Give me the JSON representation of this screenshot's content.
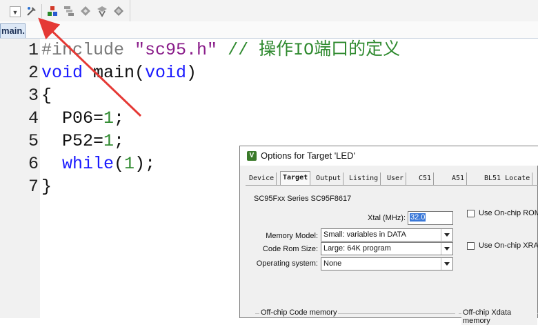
{
  "toolbar": {
    "icons": [
      "dropdown-arrow-icon",
      "target-options-icon",
      "component-manager-icon",
      "environment-icon",
      "translate-icon",
      "batch-build-icon",
      "manage-icon"
    ]
  },
  "file_tab": {
    "label": "main.c"
  },
  "editor": {
    "lines": [
      {
        "number": "1",
        "parts": [
          {
            "t": "#include ",
            "c": "pp"
          },
          {
            "t": "\"sc95.h\"",
            "c": "str"
          },
          {
            "t": " // 操作IO端口的定义",
            "c": "cmt"
          }
        ]
      },
      {
        "number": "2",
        "parts": [
          {
            "t": "void",
            "c": "kw"
          },
          {
            "t": " main(",
            "c": "txt"
          },
          {
            "t": "void",
            "c": "kw"
          },
          {
            "t": ")",
            "c": "txt"
          }
        ]
      },
      {
        "number": "3",
        "parts": [
          {
            "t": "{",
            "c": "txt"
          }
        ]
      },
      {
        "number": "4",
        "parts": [
          {
            "t": "  P06=",
            "c": "txt"
          },
          {
            "t": "1",
            "c": "num"
          },
          {
            "t": ";",
            "c": "txt"
          }
        ]
      },
      {
        "number": "5",
        "parts": [
          {
            "t": "  P52=",
            "c": "txt"
          },
          {
            "t": "1",
            "c": "num"
          },
          {
            "t": ";",
            "c": "txt"
          }
        ]
      },
      {
        "number": "6",
        "parts": [
          {
            "t": "  ",
            "c": "txt"
          },
          {
            "t": "while",
            "c": "kw"
          },
          {
            "t": "(",
            "c": "txt"
          },
          {
            "t": "1",
            "c": "num"
          },
          {
            "t": ");",
            "c": "txt"
          }
        ]
      },
      {
        "number": "7",
        "parts": [
          {
            "t": "}",
            "c": "txt"
          }
        ]
      }
    ]
  },
  "dialog": {
    "title": "Options for Target 'LED'",
    "tabs": [
      "Device",
      "Target",
      "Output",
      "Listing",
      "User",
      "C51",
      "A51",
      "BL51 Locate"
    ],
    "active_tab": "Target",
    "series": "SC95Fxx Series SC95F8617",
    "xtal_label": "Xtal (MHz):",
    "xtal_value": "32.0",
    "memory_model_label": "Memory Model:",
    "memory_model_value": "Small: variables in DATA",
    "code_rom_label": "Code Rom Size:",
    "code_rom_value": "Large: 64K program",
    "os_label": "Operating system:",
    "os_value": "None",
    "use_onchip_rom": "Use On-chip ROM",
    "use_onchip_xram": "Use On-chip XRAM",
    "offchip_code": "Off-chip Code memory",
    "offchip_xdata": "Off-chip Xdata memory"
  },
  "colors": {
    "arrow": "#e53935",
    "keyword": "#1a1aff",
    "comment": "#2f8a2f",
    "string": "#8a1d8a"
  }
}
